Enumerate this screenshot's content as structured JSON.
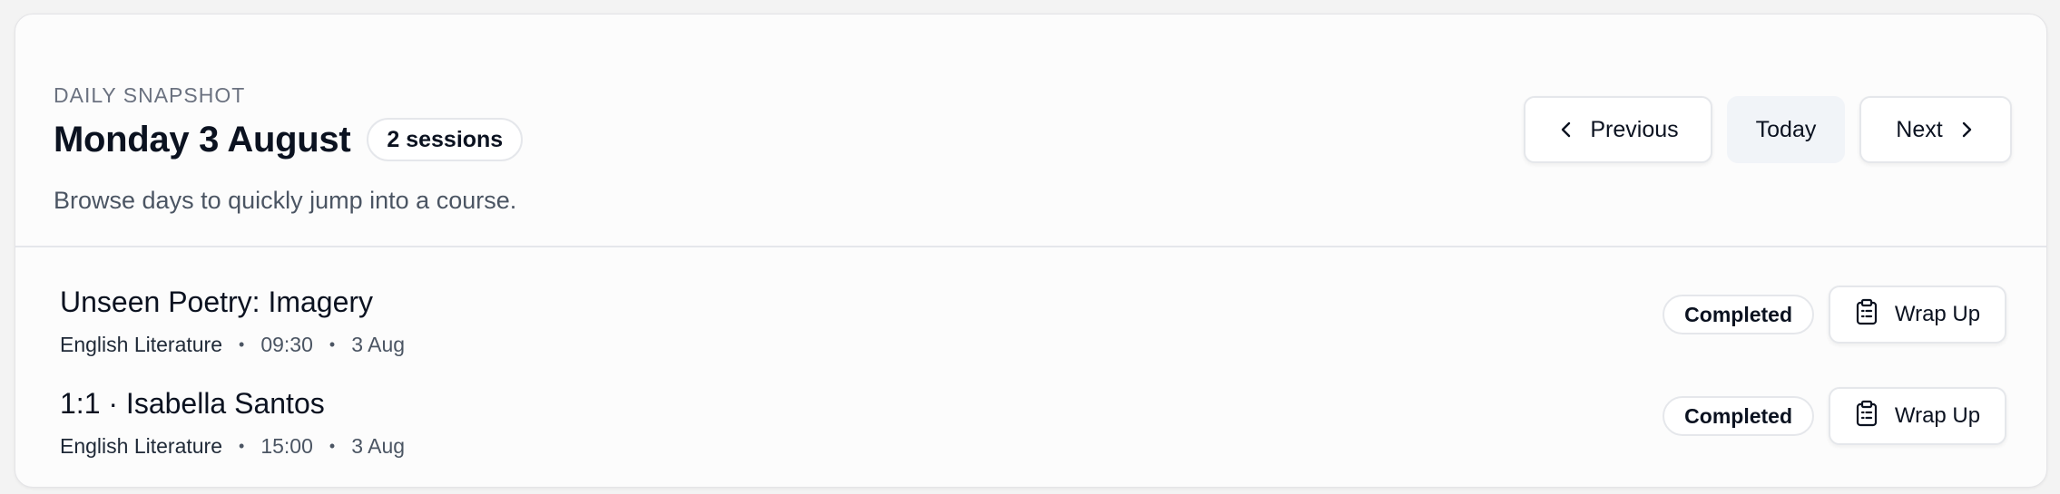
{
  "header": {
    "eyebrow": "DAILY SNAPSHOT",
    "title": "Monday 3 August",
    "session_count": "2 sessions",
    "subtitle": "Browse days to quickly jump into a course."
  },
  "nav": {
    "previous_label": "Previous",
    "today_label": "Today",
    "next_label": "Next"
  },
  "sessions": [
    {
      "title": "Unseen Poetry: Imagery",
      "subject": "English Literature",
      "time": "09:30",
      "date": "3 Aug",
      "status": "Completed",
      "action_label": "Wrap Up"
    },
    {
      "title": "1:1 · Isabella Santos",
      "subject": "English Literature",
      "time": "15:00",
      "date": "3 Aug",
      "status": "Completed",
      "action_label": "Wrap Up"
    }
  ],
  "separator": "•",
  "icons": {
    "previous": "chevron-left-icon",
    "next": "chevron-right-icon",
    "wrap_up": "clipboard-icon"
  }
}
